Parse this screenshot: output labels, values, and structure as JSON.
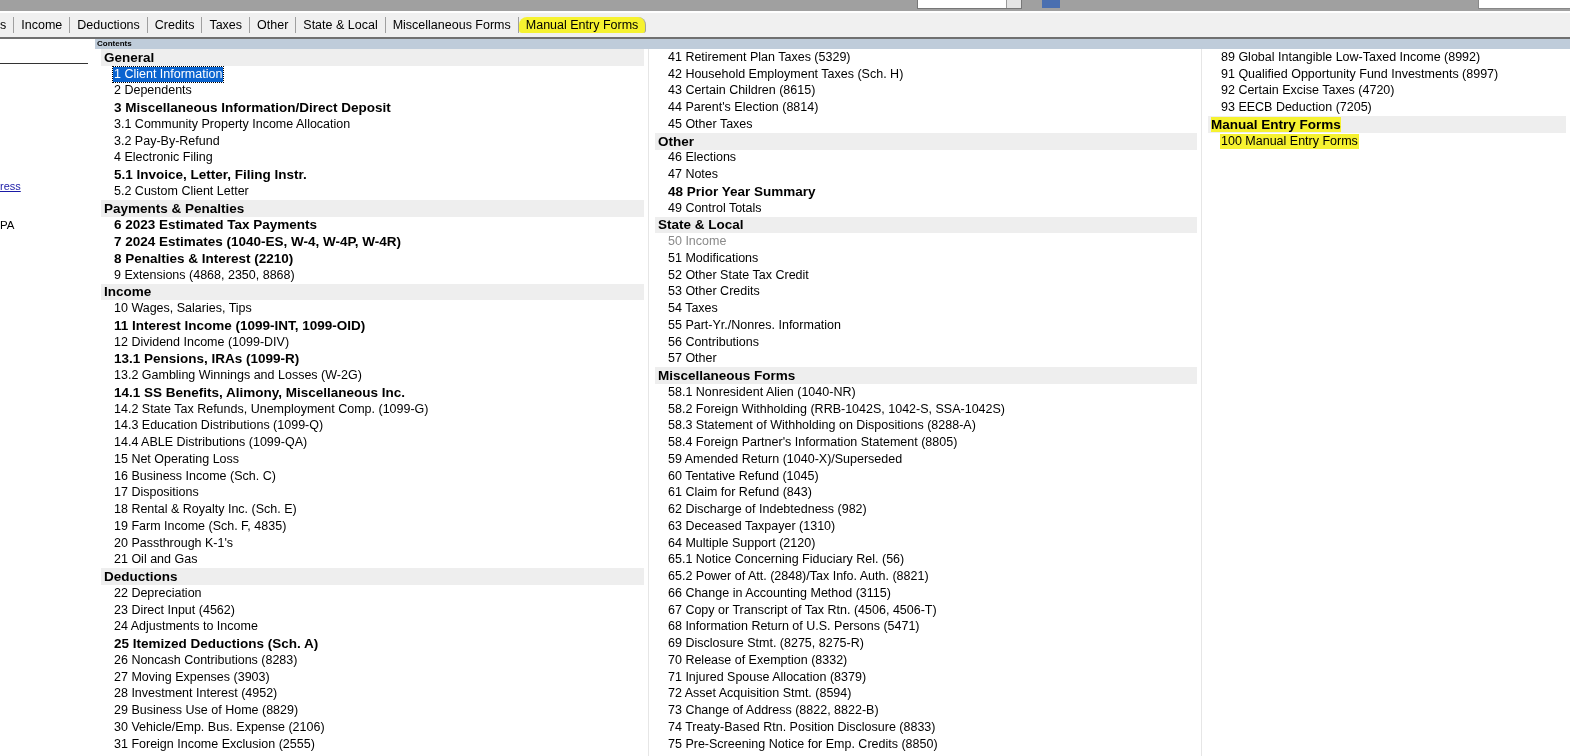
{
  "tabs": [
    {
      "label": "s",
      "highlighted": false
    },
    {
      "label": "Income",
      "highlighted": false
    },
    {
      "label": "Deductions",
      "highlighted": false
    },
    {
      "label": "Credits",
      "highlighted": false
    },
    {
      "label": "Taxes",
      "highlighted": false
    },
    {
      "label": "Other",
      "highlighted": false
    },
    {
      "label": "State & Local",
      "highlighted": false
    },
    {
      "label": "Miscellaneous Forms",
      "highlighted": false
    },
    {
      "label": "Manual Entry Forms",
      "highlighted": true
    }
  ],
  "side_panel": {
    "link": "ress",
    "text": "PA"
  },
  "contents": {
    "title": "Contents",
    "columns": [
      [
        {
          "kind": "section",
          "label": "General",
          "highlighted": false
        },
        {
          "kind": "item",
          "label": "1  Client Information",
          "bold": false,
          "disabled": false,
          "selected": true,
          "highlighted": false
        },
        {
          "kind": "item",
          "label": "2  Dependents",
          "bold": false,
          "disabled": false,
          "selected": false,
          "highlighted": false
        },
        {
          "kind": "item",
          "label": "3  Miscellaneous Information/Direct Deposit",
          "bold": true,
          "disabled": false,
          "selected": false,
          "highlighted": false
        },
        {
          "kind": "item",
          "label": "3.1 Community Property Income Allocation",
          "bold": false,
          "disabled": false,
          "selected": false,
          "highlighted": false
        },
        {
          "kind": "item",
          "label": "3.2 Pay-By-Refund",
          "bold": false,
          "disabled": false,
          "selected": false,
          "highlighted": false
        },
        {
          "kind": "item",
          "label": "4  Electronic Filing",
          "bold": false,
          "disabled": false,
          "selected": false,
          "highlighted": false
        },
        {
          "kind": "item",
          "label": "5.1 Invoice, Letter, Filing Instr.",
          "bold": true,
          "disabled": false,
          "selected": false,
          "highlighted": false
        },
        {
          "kind": "item",
          "label": "5.2 Custom Client Letter",
          "bold": false,
          "disabled": false,
          "selected": false,
          "highlighted": false
        },
        {
          "kind": "section",
          "label": "Payments & Penalties",
          "highlighted": false
        },
        {
          "kind": "item",
          "label": "6  2023 Estimated Tax Payments",
          "bold": true,
          "disabled": false,
          "selected": false,
          "highlighted": false
        },
        {
          "kind": "item",
          "label": "7  2024 Estimates (1040-ES, W-4, W-4P, W-4R)",
          "bold": true,
          "disabled": false,
          "selected": false,
          "highlighted": false
        },
        {
          "kind": "item",
          "label": "8  Penalties & Interest (2210)",
          "bold": true,
          "disabled": false,
          "selected": false,
          "highlighted": false
        },
        {
          "kind": "item",
          "label": "9  Extensions (4868, 2350, 8868)",
          "bold": false,
          "disabled": false,
          "selected": false,
          "highlighted": false
        },
        {
          "kind": "section",
          "label": "Income",
          "highlighted": false
        },
        {
          "kind": "item",
          "label": "10 Wages, Salaries, Tips",
          "bold": false,
          "disabled": false,
          "selected": false,
          "highlighted": false
        },
        {
          "kind": "item",
          "label": "11 Interest Income (1099-INT, 1099-OID)",
          "bold": true,
          "disabled": false,
          "selected": false,
          "highlighted": false
        },
        {
          "kind": "item",
          "label": "12 Dividend Income (1099-DIV)",
          "bold": false,
          "disabled": false,
          "selected": false,
          "highlighted": false
        },
        {
          "kind": "item",
          "label": "13.1 Pensions, IRAs (1099-R)",
          "bold": true,
          "disabled": false,
          "selected": false,
          "highlighted": false
        },
        {
          "kind": "item",
          "label": "13.2 Gambling Winnings and Losses (W-2G)",
          "bold": false,
          "disabled": false,
          "selected": false,
          "highlighted": false
        },
        {
          "kind": "item",
          "label": "14.1 SS Benefits, Alimony, Miscellaneous Inc.",
          "bold": true,
          "disabled": false,
          "selected": false,
          "highlighted": false
        },
        {
          "kind": "item",
          "label": "14.2 State Tax Refunds, Unemployment Comp. (1099-G)",
          "bold": false,
          "disabled": false,
          "selected": false,
          "highlighted": false
        },
        {
          "kind": "item",
          "label": "14.3 Education Distributions (1099-Q)",
          "bold": false,
          "disabled": false,
          "selected": false,
          "highlighted": false
        },
        {
          "kind": "item",
          "label": "14.4 ABLE Distributions (1099-QA)",
          "bold": false,
          "disabled": false,
          "selected": false,
          "highlighted": false
        },
        {
          "kind": "item",
          "label": "15 Net Operating Loss",
          "bold": false,
          "disabled": false,
          "selected": false,
          "highlighted": false
        },
        {
          "kind": "item",
          "label": "16 Business Income (Sch. C)",
          "bold": false,
          "disabled": false,
          "selected": false,
          "highlighted": false
        },
        {
          "kind": "item",
          "label": "17 Dispositions",
          "bold": false,
          "disabled": false,
          "selected": false,
          "highlighted": false
        },
        {
          "kind": "item",
          "label": "18 Rental & Royalty Inc. (Sch. E)",
          "bold": false,
          "disabled": false,
          "selected": false,
          "highlighted": false
        },
        {
          "kind": "item",
          "label": "19 Farm Income (Sch. F, 4835)",
          "bold": false,
          "disabled": false,
          "selected": false,
          "highlighted": false
        },
        {
          "kind": "item",
          "label": "20 Passthrough K-1's",
          "bold": false,
          "disabled": false,
          "selected": false,
          "highlighted": false
        },
        {
          "kind": "item",
          "label": "21 Oil and Gas",
          "bold": false,
          "disabled": false,
          "selected": false,
          "highlighted": false
        },
        {
          "kind": "section",
          "label": "Deductions",
          "highlighted": false
        },
        {
          "kind": "item",
          "label": "22 Depreciation",
          "bold": false,
          "disabled": false,
          "selected": false,
          "highlighted": false
        },
        {
          "kind": "item",
          "label": "23 Direct Input (4562)",
          "bold": false,
          "disabled": false,
          "selected": false,
          "highlighted": false
        },
        {
          "kind": "item",
          "label": "24 Adjustments to Income",
          "bold": false,
          "disabled": false,
          "selected": false,
          "highlighted": false
        },
        {
          "kind": "item",
          "label": "25 Itemized Deductions (Sch. A)",
          "bold": true,
          "disabled": false,
          "selected": false,
          "highlighted": false
        },
        {
          "kind": "item",
          "label": "26 Noncash Contributions (8283)",
          "bold": false,
          "disabled": false,
          "selected": false,
          "highlighted": false
        },
        {
          "kind": "item",
          "label": "27 Moving Expenses (3903)",
          "bold": false,
          "disabled": false,
          "selected": false,
          "highlighted": false
        },
        {
          "kind": "item",
          "label": "28 Investment Interest (4952)",
          "bold": false,
          "disabled": false,
          "selected": false,
          "highlighted": false
        },
        {
          "kind": "item",
          "label": "29 Business Use of Home (8829)",
          "bold": false,
          "disabled": false,
          "selected": false,
          "highlighted": false
        },
        {
          "kind": "item",
          "label": "30 Vehicle/Emp. Bus. Expense (2106)",
          "bold": false,
          "disabled": false,
          "selected": false,
          "highlighted": false
        },
        {
          "kind": "item",
          "label": "31 Foreign Income Exclusion (2555)",
          "bold": false,
          "disabled": false,
          "selected": false,
          "highlighted": false
        }
      ],
      [
        {
          "kind": "item",
          "label": "41 Retirement Plan Taxes (5329)",
          "bold": false,
          "disabled": false,
          "selected": false,
          "highlighted": false
        },
        {
          "kind": "item",
          "label": "42 Household Employment Taxes (Sch. H)",
          "bold": false,
          "disabled": false,
          "selected": false,
          "highlighted": false
        },
        {
          "kind": "item",
          "label": "43 Certain Children (8615)",
          "bold": false,
          "disabled": false,
          "selected": false,
          "highlighted": false
        },
        {
          "kind": "item",
          "label": "44 Parent's Election (8814)",
          "bold": false,
          "disabled": false,
          "selected": false,
          "highlighted": false
        },
        {
          "kind": "item",
          "label": "45 Other Taxes",
          "bold": false,
          "disabled": false,
          "selected": false,
          "highlighted": false
        },
        {
          "kind": "section",
          "label": "Other",
          "highlighted": false
        },
        {
          "kind": "item",
          "label": "46 Elections",
          "bold": false,
          "disabled": false,
          "selected": false,
          "highlighted": false
        },
        {
          "kind": "item",
          "label": "47 Notes",
          "bold": false,
          "disabled": false,
          "selected": false,
          "highlighted": false
        },
        {
          "kind": "item",
          "label": "48 Prior Year Summary",
          "bold": true,
          "disabled": false,
          "selected": false,
          "highlighted": false
        },
        {
          "kind": "item",
          "label": "49 Control Totals",
          "bold": false,
          "disabled": false,
          "selected": false,
          "highlighted": false
        },
        {
          "kind": "section",
          "label": "State & Local",
          "highlighted": false
        },
        {
          "kind": "item",
          "label": "50 Income",
          "bold": false,
          "disabled": true,
          "selected": false,
          "highlighted": false
        },
        {
          "kind": "item",
          "label": "51 Modifications",
          "bold": false,
          "disabled": false,
          "selected": false,
          "highlighted": false
        },
        {
          "kind": "item",
          "label": "52 Other State Tax Credit",
          "bold": false,
          "disabled": false,
          "selected": false,
          "highlighted": false
        },
        {
          "kind": "item",
          "label": "53 Other Credits",
          "bold": false,
          "disabled": false,
          "selected": false,
          "highlighted": false
        },
        {
          "kind": "item",
          "label": "54 Taxes",
          "bold": false,
          "disabled": false,
          "selected": false,
          "highlighted": false
        },
        {
          "kind": "item",
          "label": "55 Part-Yr./Nonres. Information",
          "bold": false,
          "disabled": false,
          "selected": false,
          "highlighted": false
        },
        {
          "kind": "item",
          "label": "56 Contributions",
          "bold": false,
          "disabled": false,
          "selected": false,
          "highlighted": false
        },
        {
          "kind": "item",
          "label": "57 Other",
          "bold": false,
          "disabled": false,
          "selected": false,
          "highlighted": false
        },
        {
          "kind": "section",
          "label": "Miscellaneous Forms",
          "highlighted": false
        },
        {
          "kind": "item",
          "label": "58.1 Nonresident Alien (1040-NR)",
          "bold": false,
          "disabled": false,
          "selected": false,
          "highlighted": false
        },
        {
          "kind": "item",
          "label": "58.2 Foreign Withholding (RRB-1042S, 1042-S, SSA-1042S)",
          "bold": false,
          "disabled": false,
          "selected": false,
          "highlighted": false
        },
        {
          "kind": "item",
          "label": "58.3 Statement of Withholding on Dispositions (8288-A)",
          "bold": false,
          "disabled": false,
          "selected": false,
          "highlighted": false
        },
        {
          "kind": "item",
          "label": "58.4 Foreign Partner's Information Statement (8805)",
          "bold": false,
          "disabled": false,
          "selected": false,
          "highlighted": false
        },
        {
          "kind": "item",
          "label": "59 Amended Return (1040-X)/Superseded",
          "bold": false,
          "disabled": false,
          "selected": false,
          "highlighted": false
        },
        {
          "kind": "item",
          "label": "60 Tentative Refund (1045)",
          "bold": false,
          "disabled": false,
          "selected": false,
          "highlighted": false
        },
        {
          "kind": "item",
          "label": "61 Claim for Refund (843)",
          "bold": false,
          "disabled": false,
          "selected": false,
          "highlighted": false
        },
        {
          "kind": "item",
          "label": "62 Discharge of Indebtedness (982)",
          "bold": false,
          "disabled": false,
          "selected": false,
          "highlighted": false
        },
        {
          "kind": "item",
          "label": "63 Deceased Taxpayer (1310)",
          "bold": false,
          "disabled": false,
          "selected": false,
          "highlighted": false
        },
        {
          "kind": "item",
          "label": "64 Multiple Support (2120)",
          "bold": false,
          "disabled": false,
          "selected": false,
          "highlighted": false
        },
        {
          "kind": "item",
          "label": "65.1 Notice Concerning Fiduciary Rel. (56)",
          "bold": false,
          "disabled": false,
          "selected": false,
          "highlighted": false
        },
        {
          "kind": "item",
          "label": "65.2 Power of Att. (2848)/Tax Info. Auth. (8821)",
          "bold": false,
          "disabled": false,
          "selected": false,
          "highlighted": false
        },
        {
          "kind": "item",
          "label": "66 Change in Accounting Method (3115)",
          "bold": false,
          "disabled": false,
          "selected": false,
          "highlighted": false
        },
        {
          "kind": "item",
          "label": "67 Copy or Transcript of Tax Rtn. (4506, 4506-T)",
          "bold": false,
          "disabled": false,
          "selected": false,
          "highlighted": false
        },
        {
          "kind": "item",
          "label": "68 Information Return of U.S. Persons (5471)",
          "bold": false,
          "disabled": false,
          "selected": false,
          "highlighted": false
        },
        {
          "kind": "item",
          "label": "69 Disclosure Stmt. (8275, 8275-R)",
          "bold": false,
          "disabled": false,
          "selected": false,
          "highlighted": false
        },
        {
          "kind": "item",
          "label": "70 Release of Exemption (8332)",
          "bold": false,
          "disabled": false,
          "selected": false,
          "highlighted": false
        },
        {
          "kind": "item",
          "label": "71 Injured Spouse Allocation (8379)",
          "bold": false,
          "disabled": false,
          "selected": false,
          "highlighted": false
        },
        {
          "kind": "item",
          "label": "72 Asset Acquisition Stmt. (8594)",
          "bold": false,
          "disabled": false,
          "selected": false,
          "highlighted": false
        },
        {
          "kind": "item",
          "label": "73 Change of Address (8822, 8822-B)",
          "bold": false,
          "disabled": false,
          "selected": false,
          "highlighted": false
        },
        {
          "kind": "item",
          "label": "74 Treaty-Based Rtn. Position Disclosure (8833)",
          "bold": false,
          "disabled": false,
          "selected": false,
          "highlighted": false
        },
        {
          "kind": "item",
          "label": "75 Pre-Screening Notice for Emp. Credits (8850)",
          "bold": false,
          "disabled": false,
          "selected": false,
          "highlighted": false
        }
      ],
      [
        {
          "kind": "item",
          "label": "89 Global Intangible Low-Taxed Income (8992)",
          "bold": false,
          "disabled": false,
          "selected": false,
          "highlighted": false
        },
        {
          "kind": "item",
          "label": "91 Qualified Opportunity Fund Investments (8997)",
          "bold": false,
          "disabled": false,
          "selected": false,
          "highlighted": false
        },
        {
          "kind": "item",
          "label": "92 Certain Excise Taxes (4720)",
          "bold": false,
          "disabled": false,
          "selected": false,
          "highlighted": false
        },
        {
          "kind": "item",
          "label": "93 EECB Deduction (7205)",
          "bold": false,
          "disabled": false,
          "selected": false,
          "highlighted": false
        },
        {
          "kind": "section",
          "label": "Manual Entry Forms",
          "highlighted": true
        },
        {
          "kind": "item",
          "label": "100  Manual Entry Forms",
          "bold": false,
          "disabled": false,
          "selected": false,
          "highlighted": true
        }
      ]
    ]
  }
}
